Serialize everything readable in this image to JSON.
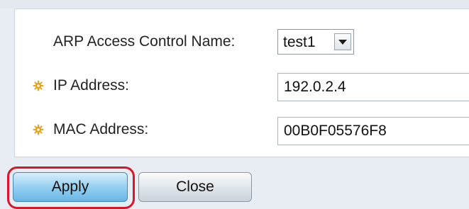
{
  "form": {
    "acl_name": {
      "label": "ARP Access Control Name:",
      "selected": "test1"
    },
    "ip_address": {
      "label": "IP Address:",
      "value": "192.0.2.4",
      "required": true
    },
    "mac_address": {
      "label": "MAC Address:",
      "value": "00B0F05576F8",
      "required": true
    }
  },
  "buttons": {
    "apply_label": "Apply",
    "close_label": "Close"
  },
  "colors": {
    "required_icon": "#e8a21a",
    "highlight": "#d9162b",
    "apply_button": "#8fcdf0"
  },
  "icons": {
    "required": "required-field-icon",
    "dropdown": "chevron-down-icon"
  }
}
